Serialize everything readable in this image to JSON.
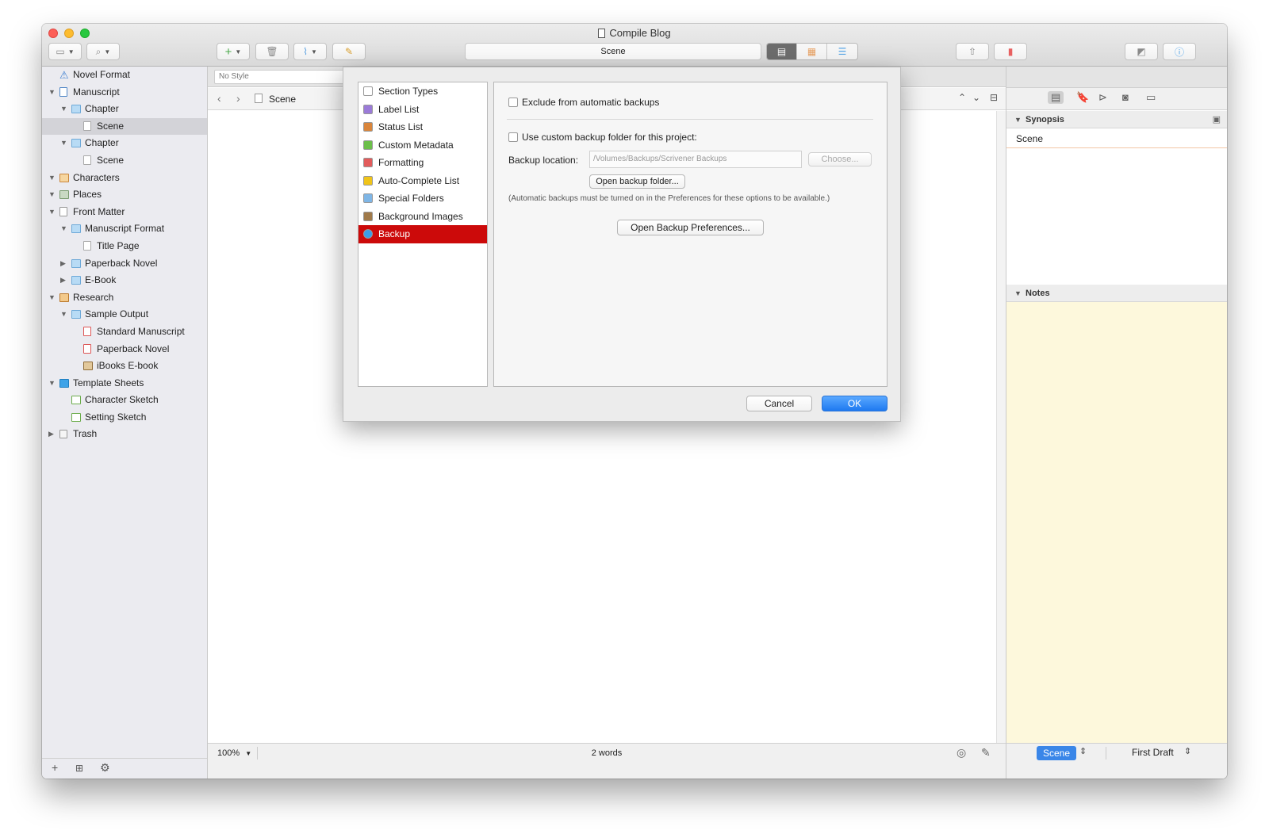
{
  "window": {
    "title": "Compile Blog"
  },
  "toolbar": {
    "title_field": "Scene"
  },
  "format_bar": {
    "style": "No Style"
  },
  "binder": {
    "items": [
      {
        "label": "Novel Format",
        "level": 0,
        "icon": "warning-icon",
        "toggle": ""
      },
      {
        "label": "Manuscript",
        "level": 0,
        "icon": "manuscript-icon",
        "toggle": "▼"
      },
      {
        "label": "Chapter",
        "level": 1,
        "icon": "folder-icon",
        "toggle": "▼"
      },
      {
        "label": "Scene",
        "level": 2,
        "icon": "document-icon",
        "toggle": "",
        "selected": true
      },
      {
        "label": "Chapter",
        "level": 1,
        "icon": "folder-icon",
        "toggle": "▼"
      },
      {
        "label": "Scene",
        "level": 2,
        "icon": "document-icon",
        "toggle": ""
      },
      {
        "label": "Characters",
        "level": 0,
        "icon": "characters-icon",
        "toggle": "▼"
      },
      {
        "label": "Places",
        "level": 0,
        "icon": "places-icon",
        "toggle": "▼"
      },
      {
        "label": "Front Matter",
        "level": 0,
        "icon": "front-matter-icon",
        "toggle": "▼"
      },
      {
        "label": "Manuscript Format",
        "level": 1,
        "icon": "folder-icon",
        "toggle": "▼"
      },
      {
        "label": "Title Page",
        "level": 2,
        "icon": "document-icon",
        "toggle": ""
      },
      {
        "label": "Paperback Novel",
        "level": 1,
        "icon": "folder-icon",
        "toggle": "▶"
      },
      {
        "label": "E-Book",
        "level": 1,
        "icon": "folder-icon",
        "toggle": "▶"
      },
      {
        "label": "Research",
        "level": 0,
        "icon": "research-icon",
        "toggle": "▼"
      },
      {
        "label": "Sample Output",
        "level": 1,
        "icon": "folder-icon",
        "toggle": "▼"
      },
      {
        "label": "Standard Manuscript",
        "level": 2,
        "icon": "pdf-icon",
        "toggle": ""
      },
      {
        "label": "Paperback Novel",
        "level": 2,
        "icon": "pdf-icon",
        "toggle": ""
      },
      {
        "label": "iBooks E-book",
        "level": 2,
        "icon": "image-icon",
        "toggle": ""
      },
      {
        "label": "Template Sheets",
        "level": 0,
        "icon": "template-icon",
        "toggle": "▼"
      },
      {
        "label": "Character Sketch",
        "level": 1,
        "icon": "sheet-icon",
        "toggle": ""
      },
      {
        "label": "Setting Sketch",
        "level": 1,
        "icon": "sheet-icon",
        "toggle": ""
      },
      {
        "label": "Trash",
        "level": 0,
        "icon": "trash-icon",
        "toggle": "▶"
      }
    ]
  },
  "editor": {
    "header_title": "Scene",
    "zoom": "100%",
    "word_count": "2 words"
  },
  "inspector": {
    "synopsis_header": "Synopsis",
    "synopsis_title": "Scene",
    "notes_header": "Notes",
    "label_value": "Scene",
    "status_value": "First Draft"
  },
  "dialog": {
    "categories": [
      {
        "label": "Section Types",
        "color": "#ffffff"
      },
      {
        "label": "Label List",
        "color": "#9b7bd8"
      },
      {
        "label": "Status List",
        "color": "#d9853b"
      },
      {
        "label": "Custom Metadata",
        "color": "#6cbf4a"
      },
      {
        "label": "Formatting",
        "color": "#e25b5b"
      },
      {
        "label": "Auto-Complete List",
        "color": "#f0c419"
      },
      {
        "label": "Special Folders",
        "color": "#7fb6e6"
      },
      {
        "label": "Background Images",
        "color": "#a07a4a"
      },
      {
        "label": "Backup",
        "color": "#3a9de8",
        "selected": true
      }
    ],
    "exclude_label": "Exclude from automatic backups",
    "custom_folder_label": "Use custom backup folder for this project:",
    "backup_location_label": "Backup location:",
    "backup_location_value": "/Volumes/Backups/Scrivener Backups",
    "choose_label": "Choose...",
    "open_folder_label": "Open backup folder...",
    "note": "(Automatic backups must be turned on in the Preferences for these options to be available.)",
    "open_prefs_label": "Open Backup Preferences...",
    "cancel_label": "Cancel",
    "ok_label": "OK"
  }
}
